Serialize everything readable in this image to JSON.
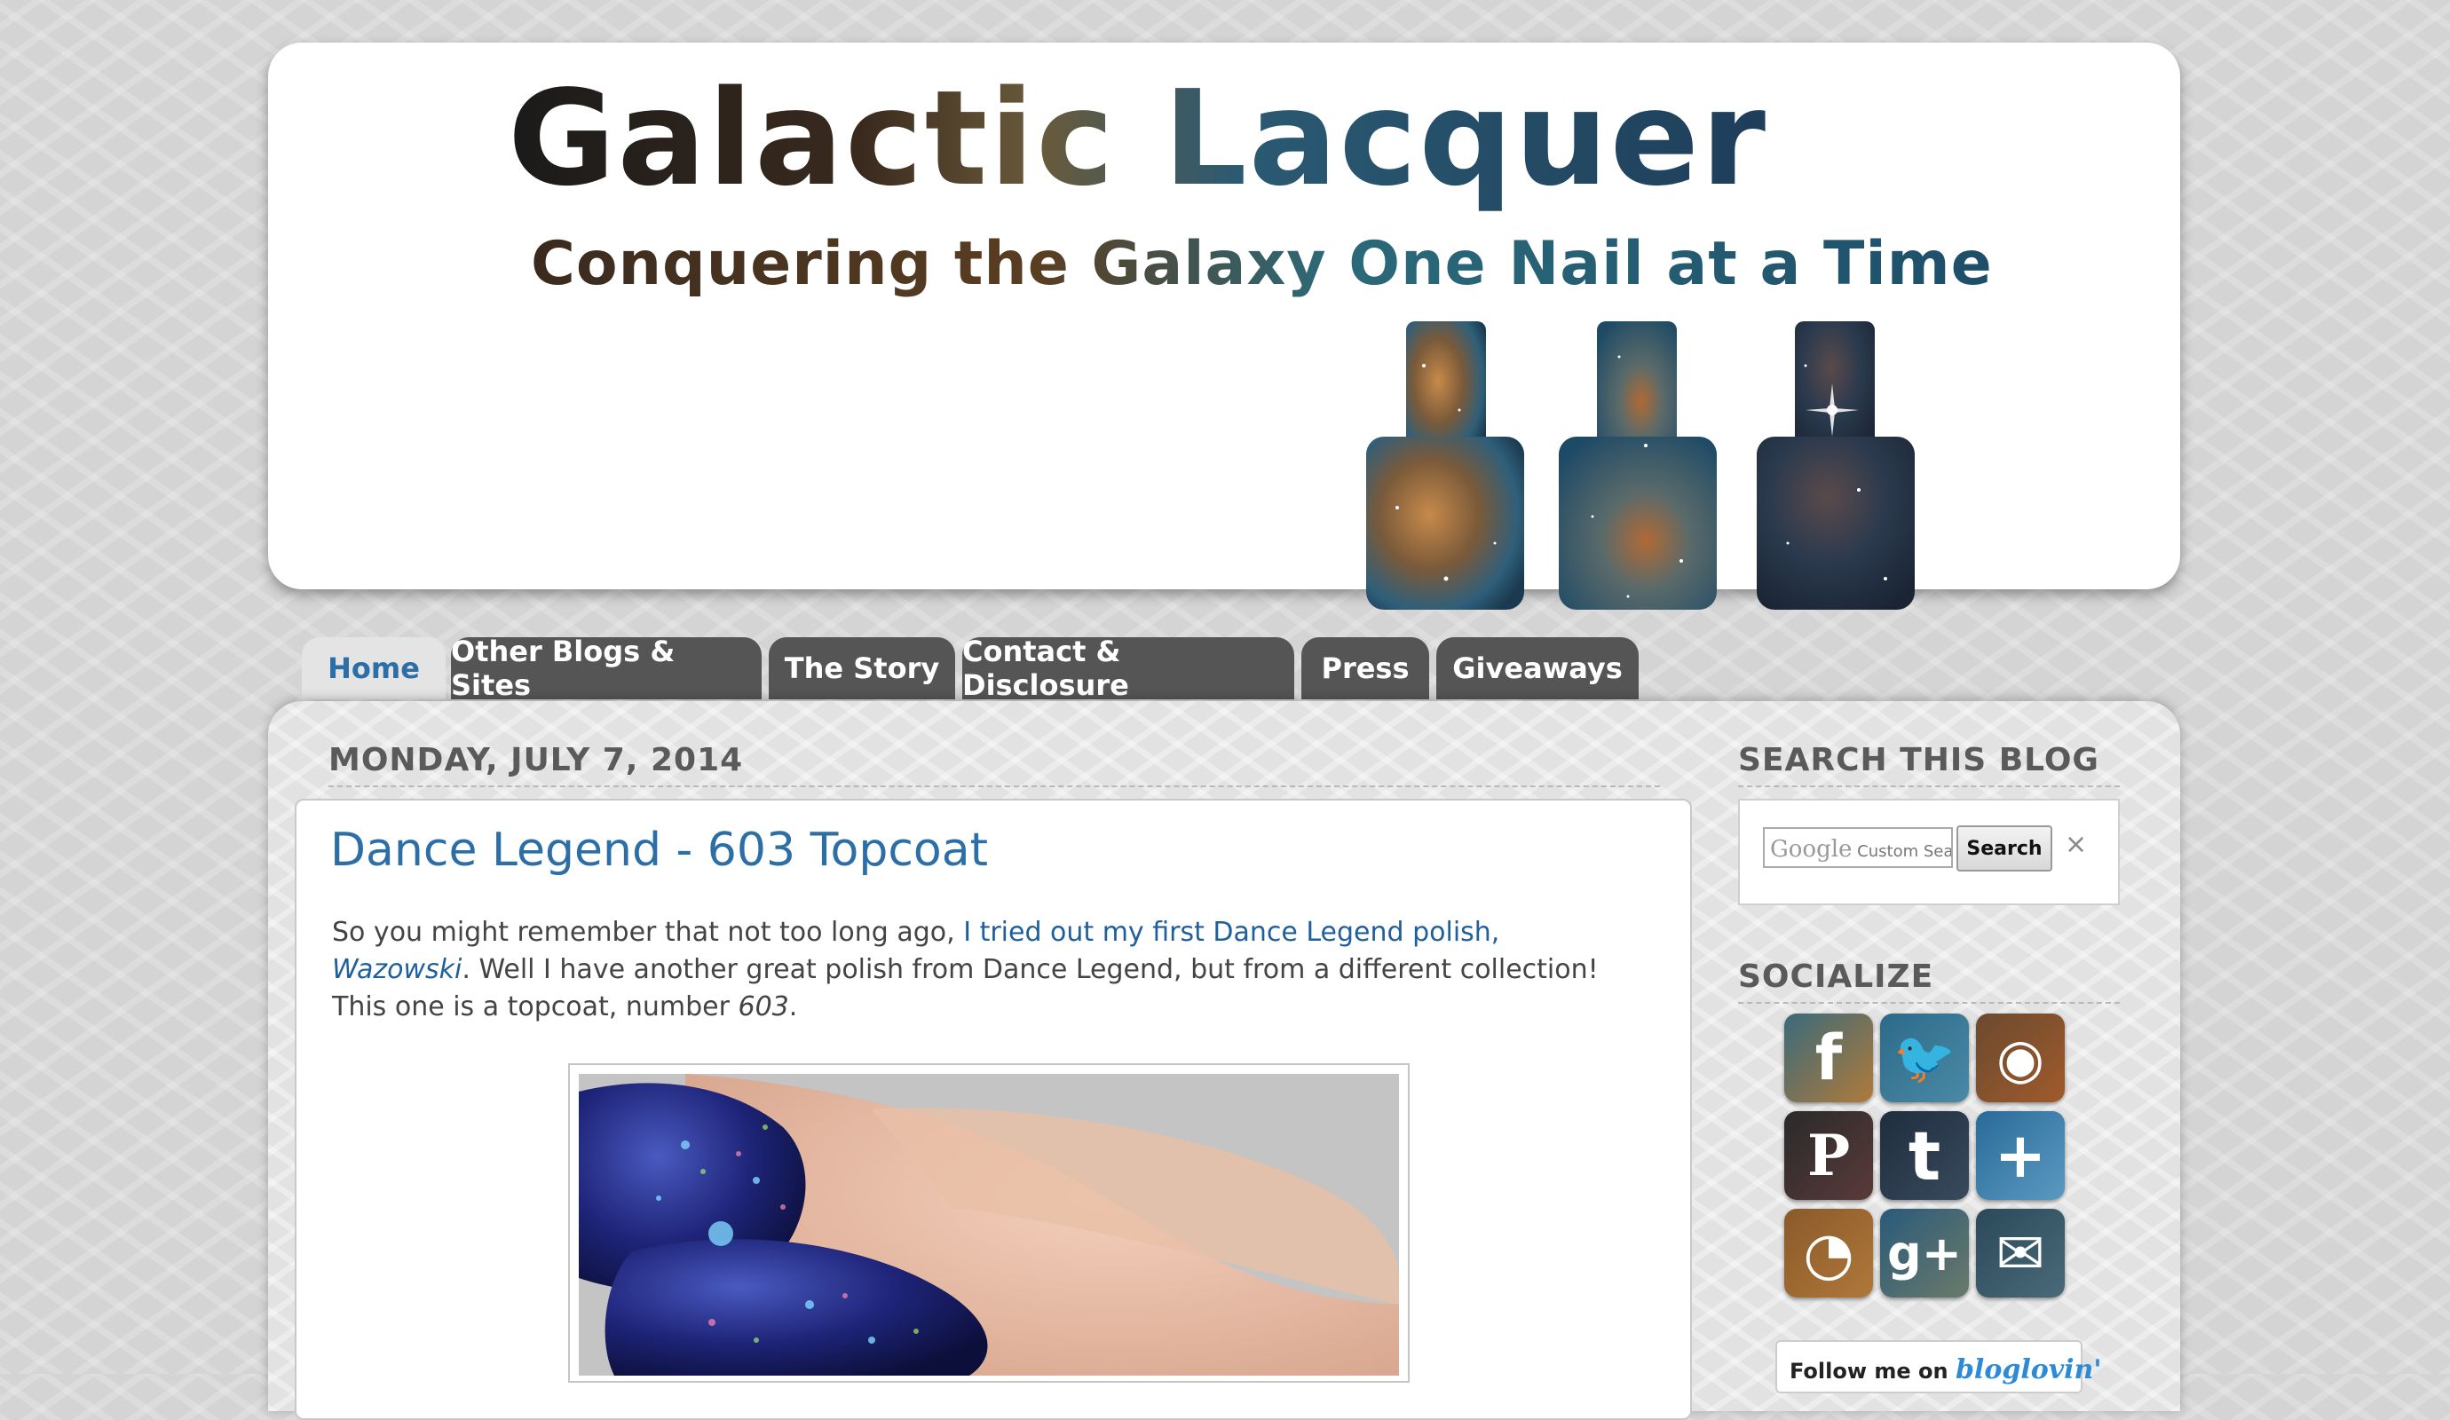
{
  "header": {
    "title": "Galactic Lacquer",
    "subtitle": "Conquering the Galaxy One Nail at a Time"
  },
  "nav": {
    "tabs": [
      {
        "label": "Home",
        "active": true
      },
      {
        "label": "Other Blogs & Sites",
        "active": false
      },
      {
        "label": "The Story",
        "active": false
      },
      {
        "label": "Contact & Disclosure",
        "active": false
      },
      {
        "label": "Press",
        "active": false
      },
      {
        "label": "Giveaways",
        "active": false
      }
    ]
  },
  "post": {
    "date": "MONDAY, JULY 7, 2014",
    "title": "Dance Legend - 603 Topcoat",
    "body": {
      "intro": "So you might remember that not too long ago, ",
      "link_text": "I tried out my first Dance Legend polish, ",
      "link_italic": "Wazowski",
      "after_link": ". Well I have another great polish from Dance Legend, but from a different collection! This one is a topcoat, number ",
      "number_italic": "603",
      "end": "."
    }
  },
  "sidebar": {
    "search": {
      "title": "SEARCH THIS BLOG",
      "brand": "Google",
      "placeholder": "Custom Search",
      "button_label": "Search",
      "clear_label": "×"
    },
    "socialize": {
      "title": "SOCIALIZE",
      "icons": [
        {
          "name": "facebook-icon",
          "glyph": "f"
        },
        {
          "name": "twitter-icon",
          "glyph": "🐦"
        },
        {
          "name": "instagram-icon",
          "glyph": "◉"
        },
        {
          "name": "pinterest-icon",
          "glyph": "P"
        },
        {
          "name": "tumblr-icon",
          "glyph": "t"
        },
        {
          "name": "plus-icon",
          "glyph": "+"
        },
        {
          "name": "rss-icon",
          "glyph": "◔"
        },
        {
          "name": "google-plus-icon",
          "glyph": "g+"
        },
        {
          "name": "email-icon",
          "glyph": "✉"
        }
      ]
    },
    "bloglovin": {
      "prefix": "Follow me on",
      "brand": "bloglovin'"
    }
  },
  "colors": {
    "link_blue": "#2c6ea6",
    "tab_dark": "#555555",
    "page_bg": "#d4d4d4"
  }
}
